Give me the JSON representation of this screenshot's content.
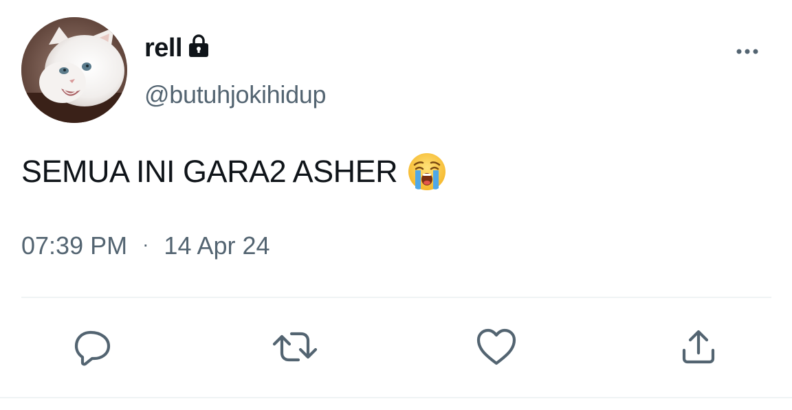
{
  "user": {
    "display_name": "rell",
    "handle": "@butuhjokihidup",
    "protected_icon": "lock-icon",
    "avatar": "white kitten photo"
  },
  "tweet": {
    "text": "SEMUA INI GARA2 ASHER",
    "emoji": "loudly-crying-face-emoji",
    "time": "07:39 PM",
    "separator": "·",
    "date": "14 Apr 24"
  },
  "actions": [
    {
      "name": "reply",
      "icon": "reply-icon"
    },
    {
      "name": "retweet",
      "icon": "retweet-icon"
    },
    {
      "name": "like",
      "icon": "heart-icon"
    },
    {
      "name": "share",
      "icon": "share-icon"
    }
  ],
  "colors": {
    "text_primary": "#0f1419",
    "text_secondary": "#536471",
    "divider": "#eff3f4"
  }
}
